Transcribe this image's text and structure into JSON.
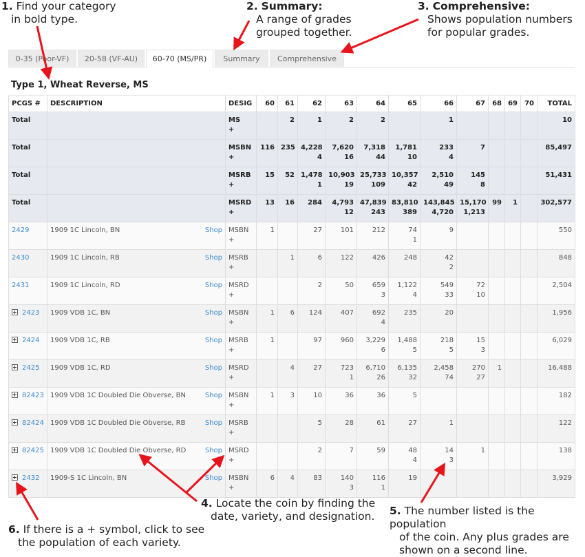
{
  "callouts": [
    {
      "num": "1.",
      "title": "",
      "text1": "Find your category",
      "text2": "in bold type."
    },
    {
      "num": "2.",
      "title": "Summary:",
      "text1": "A range of grades",
      "text2": "grouped together."
    },
    {
      "num": "3.",
      "title": "Comprehensive:",
      "text1": "Shows population numbers",
      "text2": "for popular grades."
    },
    {
      "num": "4.",
      "title": "",
      "text1": "Locate the coin by finding the",
      "text2": "date, variety, and designation."
    },
    {
      "num": "5.",
      "title": "",
      "text1": "The number listed is the population",
      "text2": "of the coin. Any plus grades are",
      "text3": "shown on a second line."
    },
    {
      "num": "6.",
      "title": "",
      "text1": "If there is a + symbol, click to see",
      "text2": "the population of each variety."
    }
  ],
  "tabs": [
    {
      "label": "0-35 (Poor-VF)",
      "active": false
    },
    {
      "label": "20-58 (VF-AU)",
      "active": false
    },
    {
      "label": "60-70 (MS/PR)",
      "active": true
    },
    {
      "label": "Summary",
      "active": false
    },
    {
      "label": "Comprehensive",
      "active": false
    }
  ],
  "category_title": "Type 1, Wheat Reverse, MS",
  "table": {
    "headers": [
      "PCGS #",
      "DESCRIPTION",
      "DESIG",
      "60",
      "61",
      "62",
      "63",
      "64",
      "65",
      "66",
      "67",
      "68",
      "69",
      "70",
      "TOTAL"
    ],
    "shop_label": "Shop",
    "plus_symbol": "+",
    "totals": [
      {
        "label": "Total",
        "desig": "MS",
        "grades": [
          [
            "",
            ""
          ],
          [
            "2",
            ""
          ],
          [
            "1",
            ""
          ],
          [
            "2",
            ""
          ],
          [
            "2",
            ""
          ],
          [
            "",
            ""
          ],
          [
            "1",
            ""
          ],
          [
            "",
            ""
          ],
          [
            "",
            ""
          ],
          [
            "",
            ""
          ],
          [
            "",
            ""
          ]
        ],
        "total": "10"
      },
      {
        "label": "Total",
        "desig": "MSBN",
        "grades": [
          [
            "116",
            ""
          ],
          [
            "235",
            ""
          ],
          [
            "4,228",
            "4"
          ],
          [
            "7,620",
            "16"
          ],
          [
            "7,318",
            "44"
          ],
          [
            "1,781",
            "10"
          ],
          [
            "233",
            "4"
          ],
          [
            "7",
            ""
          ],
          [
            "",
            ""
          ],
          [
            "",
            ""
          ],
          [
            "",
            ""
          ]
        ],
        "total": "85,497"
      },
      {
        "label": "Total",
        "desig": "MSRB",
        "grades": [
          [
            "15",
            ""
          ],
          [
            "52",
            ""
          ],
          [
            "1,478",
            "1"
          ],
          [
            "10,903",
            "19"
          ],
          [
            "25,733",
            "109"
          ],
          [
            "10,357",
            "42"
          ],
          [
            "2,510",
            "49"
          ],
          [
            "145",
            "8"
          ],
          [
            "",
            ""
          ],
          [
            "",
            ""
          ],
          [
            "",
            ""
          ]
        ],
        "total": "51,431"
      },
      {
        "label": "Total",
        "desig": "MSRD",
        "grades": [
          [
            "13",
            ""
          ],
          [
            "16",
            ""
          ],
          [
            "284",
            ""
          ],
          [
            "4,793",
            "12"
          ],
          [
            "47,839",
            "243"
          ],
          [
            "83,810",
            "389"
          ],
          [
            "143,845",
            "4,720"
          ],
          [
            "15,170",
            "1,213"
          ],
          [
            "99",
            ""
          ],
          [
            "1",
            ""
          ],
          [
            "",
            ""
          ]
        ],
        "total": "302,577"
      }
    ],
    "rows": [
      {
        "pcgs": "2429",
        "expandable": false,
        "description": "1909 1C Lincoln, BN",
        "desig": "MSBN",
        "grades": [
          [
            "1",
            ""
          ],
          [
            "",
            ""
          ],
          [
            "27",
            ""
          ],
          [
            "101",
            ""
          ],
          [
            "212",
            ""
          ],
          [
            "74",
            "1"
          ],
          [
            "9",
            ""
          ],
          [
            "",
            ""
          ],
          [
            "",
            ""
          ],
          [
            "",
            ""
          ],
          [
            "",
            ""
          ]
        ],
        "total": "550"
      },
      {
        "pcgs": "2430",
        "expandable": false,
        "description": "1909 1C Lincoln, RB",
        "desig": "MSRB",
        "grades": [
          [
            "",
            ""
          ],
          [
            "1",
            ""
          ],
          [
            "6",
            ""
          ],
          [
            "122",
            ""
          ],
          [
            "426",
            ""
          ],
          [
            "248",
            ""
          ],
          [
            "42",
            "2"
          ],
          [
            "",
            ""
          ],
          [
            "",
            ""
          ],
          [
            "",
            ""
          ],
          [
            "",
            ""
          ]
        ],
        "total": "848"
      },
      {
        "pcgs": "2431",
        "expandable": false,
        "description": "1909 1C Lincoln, RD",
        "desig": "MSRD",
        "grades": [
          [
            "",
            ""
          ],
          [
            "",
            ""
          ],
          [
            "2",
            ""
          ],
          [
            "50",
            ""
          ],
          [
            "659",
            "3"
          ],
          [
            "1,122",
            "4"
          ],
          [
            "549",
            "33"
          ],
          [
            "72",
            "10"
          ],
          [
            "",
            ""
          ],
          [
            "",
            ""
          ],
          [
            "",
            ""
          ]
        ],
        "total": "2,504"
      },
      {
        "pcgs": "2423",
        "expandable": true,
        "description": "1909 VDB 1C, BN",
        "desig": "MSBN",
        "grades": [
          [
            "1",
            ""
          ],
          [
            "6",
            ""
          ],
          [
            "124",
            ""
          ],
          [
            "407",
            ""
          ],
          [
            "692",
            "4"
          ],
          [
            "235",
            ""
          ],
          [
            "20",
            ""
          ],
          [
            "",
            ""
          ],
          [
            "",
            ""
          ],
          [
            "",
            ""
          ],
          [
            "",
            ""
          ]
        ],
        "total": "1,956"
      },
      {
        "pcgs": "2424",
        "expandable": true,
        "description": "1909 VDB 1C, RB",
        "desig": "MSRB",
        "grades": [
          [
            "1",
            ""
          ],
          [
            "",
            ""
          ],
          [
            "97",
            ""
          ],
          [
            "960",
            ""
          ],
          [
            "3,229",
            "6"
          ],
          [
            "1,488",
            "5"
          ],
          [
            "218",
            "5"
          ],
          [
            "15",
            "3"
          ],
          [
            "",
            ""
          ],
          [
            "",
            ""
          ],
          [
            "",
            ""
          ]
        ],
        "total": "6,029"
      },
      {
        "pcgs": "2425",
        "expandable": true,
        "description": "1909 VDB 1C, RD",
        "desig": "MSRD",
        "grades": [
          [
            "",
            ""
          ],
          [
            "4",
            ""
          ],
          [
            "27",
            ""
          ],
          [
            "723",
            "1"
          ],
          [
            "6,710",
            "26"
          ],
          [
            "6,135",
            "32"
          ],
          [
            "2,458",
            "74"
          ],
          [
            "270",
            "27"
          ],
          [
            "1",
            ""
          ],
          [
            "",
            ""
          ],
          [
            "",
            ""
          ]
        ],
        "total": "16,488"
      },
      {
        "pcgs": "82423",
        "expandable": true,
        "description": "1909 VDB 1C Doubled Die Obverse, BN",
        "desig": "MSBN",
        "grades": [
          [
            "1",
            ""
          ],
          [
            "3",
            ""
          ],
          [
            "10",
            ""
          ],
          [
            "36",
            ""
          ],
          [
            "36",
            ""
          ],
          [
            "5",
            ""
          ],
          [
            "",
            ""
          ],
          [
            "",
            ""
          ],
          [
            "",
            ""
          ],
          [
            "",
            ""
          ],
          [
            "",
            ""
          ]
        ],
        "total": "182"
      },
      {
        "pcgs": "82424",
        "expandable": true,
        "description": "1909 VDB 1C Doubled Die Obverse, RB",
        "desig": "MSRB",
        "grades": [
          [
            "",
            ""
          ],
          [
            "",
            ""
          ],
          [
            "5",
            ""
          ],
          [
            "28",
            ""
          ],
          [
            "61",
            ""
          ],
          [
            "27",
            ""
          ],
          [
            "1",
            ""
          ],
          [
            "",
            ""
          ],
          [
            "",
            ""
          ],
          [
            "",
            ""
          ],
          [
            "",
            ""
          ]
        ],
        "total": "122"
      },
      {
        "pcgs": "82425",
        "expandable": true,
        "description": "1909 VDB 1C Doubled Die Obverse, RD",
        "desig": "MSRD",
        "grades": [
          [
            "",
            ""
          ],
          [
            "",
            ""
          ],
          [
            "2",
            ""
          ],
          [
            "7",
            ""
          ],
          [
            "59",
            ""
          ],
          [
            "48",
            "4"
          ],
          [
            "14",
            "3"
          ],
          [
            "1",
            ""
          ],
          [
            "",
            ""
          ],
          [
            "",
            ""
          ],
          [
            "",
            ""
          ]
        ],
        "total": "138"
      },
      {
        "pcgs": "2432",
        "expandable": true,
        "description": "1909-S 1C Lincoln, BN",
        "desig": "MSBN",
        "grades": [
          [
            "6",
            ""
          ],
          [
            "4",
            ""
          ],
          [
            "83",
            ""
          ],
          [
            "140",
            "3"
          ],
          [
            "116",
            "1"
          ],
          [
            "19",
            ""
          ],
          [
            "",
            ""
          ],
          [
            "",
            ""
          ],
          [
            "",
            ""
          ],
          [
            "",
            ""
          ],
          [
            "",
            ""
          ]
        ],
        "total": "3,929"
      }
    ]
  },
  "colors": {
    "arrow": "#e8141b",
    "link": "#3b8bd1",
    "total_row_bg": "#e6e9ef"
  }
}
